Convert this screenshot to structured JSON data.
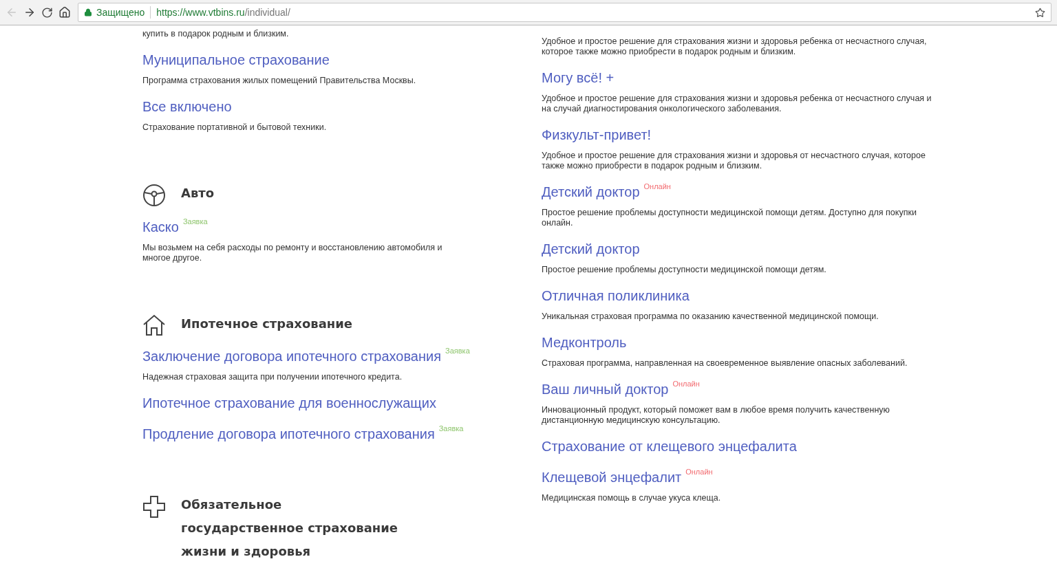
{
  "browser": {
    "secure_label": "Защищено",
    "url_host": "https://www.vtbins.ru",
    "url_path": "/individual/",
    "back_disabled": true
  },
  "left_column": [
    {
      "kind": "item",
      "description": "купить в подарок родным и близким."
    },
    {
      "kind": "item",
      "title": "Муниципальное страхование",
      "description": "Программа страхования жилых помещений Правительства Москвы."
    },
    {
      "kind": "item",
      "title": "Все включено",
      "description": "Страхование портативной и бытовой техники."
    },
    {
      "kind": "section",
      "title": "Авто"
    },
    {
      "kind": "item",
      "title": "Каско",
      "badge": {
        "text": "Заявка",
        "kind": "request"
      },
      "description": "Мы возьмем на себя расходы по ремонту и восстановлению автомобиля и многое другое."
    },
    {
      "kind": "section",
      "title": "Ипотечное страхование"
    },
    {
      "kind": "item",
      "title": "Заключение договора ипотечного страхования",
      "badge": {
        "text": "Заявка",
        "kind": "request"
      },
      "description": "Надежная страховая защита при получении ипотечного кредита."
    },
    {
      "kind": "item",
      "title": "Ипотечное страхование для военнослужащих"
    },
    {
      "kind": "item",
      "title": "Продление договора ипотечного страхования",
      "badge": {
        "text": "Заявка",
        "kind": "request"
      }
    },
    {
      "kind": "section",
      "title": "Обязательное государственное страхование жизни и здоровья"
    }
  ],
  "right_column": [
    {
      "kind": "item",
      "description": "Удобное и простое решение для страхования жизни и здоровья ребенка от несчастного случая, которое также можно приобрести в подарок родным и близким."
    },
    {
      "kind": "item",
      "title": "Могу всё! +",
      "description": "Удобное и простое решение для страхования жизни и здоровья ребенка от несчастного случая и на случай диагностирования онкологического заболевания."
    },
    {
      "kind": "item",
      "title": "Физкульт-привет!",
      "description": "Удобное и простое решение для страхования жизни и здоровья от несчастного случая, которое также можно приобрести в подарок родным и близким."
    },
    {
      "kind": "item",
      "title": "Детский доктор",
      "badge": {
        "text": "Онлайн",
        "kind": "online"
      },
      "description": "Простое решение проблемы доступности медицинской помощи детям. Доступно для покупки онлайн."
    },
    {
      "kind": "item",
      "title": "Детский доктор",
      "description": "Простое решение проблемы доступности медицинской помощи детям."
    },
    {
      "kind": "item",
      "title": "Отличная поликлиника",
      "description": "Уникальная страховая программа по оказанию качественной медицинской помощи."
    },
    {
      "kind": "item",
      "title": "Медконтроль",
      "description": "Страховая программа, направленная на своевременное выявление опасных заболеваний."
    },
    {
      "kind": "item",
      "title": "Ваш личный доктор",
      "badge": {
        "text": "Онлайн",
        "kind": "online"
      },
      "description": "Инновационный продукт, который поможет вам в любое время получить качественную дистанционную медицинскую консультацию."
    },
    {
      "kind": "item",
      "title": "Страхование от клещевого энцефалита"
    },
    {
      "kind": "item",
      "title": "Клещевой энцефалит",
      "badge": {
        "text": "Онлайн",
        "kind": "online"
      },
      "description": "Медицинская помощь в случае укуса клеща."
    }
  ]
}
